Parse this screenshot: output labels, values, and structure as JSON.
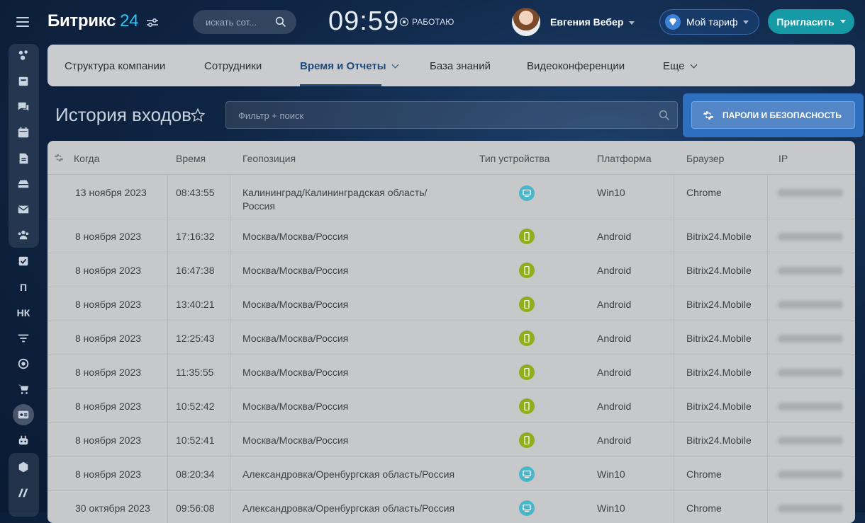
{
  "app": {
    "logo_name": "Битрикс",
    "logo_number": "24",
    "search_placeholder": "искать сот...",
    "clock": "09:59",
    "work_status": "РАБОТАЮ",
    "user_name": "Евгения Вебер",
    "tariff_label": "Мой тариф",
    "invite_label": "Пригласить"
  },
  "sidebar": {
    "items": [
      {
        "name": "feed-icon"
      },
      {
        "name": "tasks-icon"
      },
      {
        "name": "chat-icon"
      },
      {
        "name": "calendar-icon"
      },
      {
        "name": "document-icon"
      },
      {
        "name": "drive-icon"
      },
      {
        "name": "mail-icon"
      },
      {
        "name": "employees-icon"
      },
      {
        "name": "checklist-icon"
      },
      {
        "name": "text-item",
        "label": "П"
      },
      {
        "name": "text-item",
        "label": "НК"
      },
      {
        "name": "filter-icon"
      },
      {
        "name": "target-icon"
      },
      {
        "name": "cart-icon"
      },
      {
        "name": "id-card-icon"
      },
      {
        "name": "robot-icon"
      },
      {
        "name": "box-icon"
      },
      {
        "name": "logo-icon"
      }
    ]
  },
  "nav": {
    "items": [
      "Структура компании",
      "Сотрудники",
      "Время и Отчеты",
      "База знаний",
      "Видеоконференции",
      "Еще"
    ],
    "active": "Время и Отчеты"
  },
  "page": {
    "title": "История входов",
    "filter_placeholder": "Фильтр + поиск",
    "security_button": "ПАРОЛИ И БЕЗОПАСНОСТЬ"
  },
  "table": {
    "columns": [
      "Когда",
      "Время",
      "Геопозиция",
      "Тип устройства",
      "Платформа",
      "Браузер",
      "IP"
    ],
    "rows": [
      {
        "date": "13 ноября 2023",
        "time": "08:43:55",
        "geo": "Калининград/Калининградская область/\nРоссия",
        "device": "desktop",
        "platform": "Win10",
        "browser": "Chrome"
      },
      {
        "date": "8 ноября 2023",
        "time": "17:16:32",
        "geo": "Москва/Москва/Россия",
        "device": "mobile",
        "platform": "Android",
        "browser": "Bitrix24.Mobile"
      },
      {
        "date": "8 ноября 2023",
        "time": "16:47:38",
        "geo": "Москва/Москва/Россия",
        "device": "mobile",
        "platform": "Android",
        "browser": "Bitrix24.Mobile"
      },
      {
        "date": "8 ноября 2023",
        "time": "13:40:21",
        "geo": "Москва/Москва/Россия",
        "device": "mobile",
        "platform": "Android",
        "browser": "Bitrix24.Mobile"
      },
      {
        "date": "8 ноября 2023",
        "time": "12:25:43",
        "geo": "Москва/Москва/Россия",
        "device": "mobile",
        "platform": "Android",
        "browser": "Bitrix24.Mobile"
      },
      {
        "date": "8 ноября 2023",
        "time": "11:35:55",
        "geo": "Москва/Москва/Россия",
        "device": "mobile",
        "platform": "Android",
        "browser": "Bitrix24.Mobile"
      },
      {
        "date": "8 ноября 2023",
        "time": "10:52:42",
        "geo": "Москва/Москва/Россия",
        "device": "mobile",
        "platform": "Android",
        "browser": "Bitrix24.Mobile"
      },
      {
        "date": "8 ноября 2023",
        "time": "10:52:41",
        "geo": "Москва/Москва/Россия",
        "device": "mobile",
        "platform": "Android",
        "browser": "Bitrix24.Mobile"
      },
      {
        "date": "8 ноября 2023",
        "time": "08:20:34",
        "geo": "Александровка/Оренбургская область/Россия",
        "device": "desktop",
        "platform": "Win10",
        "browser": "Chrome"
      },
      {
        "date": "30 октября 2023",
        "time": "09:56:08",
        "geo": "Александровка/Оренбургская область/Россия",
        "device": "desktop",
        "platform": "Win10",
        "browser": "Chrome"
      }
    ]
  },
  "colors": {
    "accent": "#2fc6f6",
    "invite": "#159aa6",
    "security_highlight": "#2f6fbf",
    "device_desktop": "#4bb5c9",
    "device_mobile": "#8fae1b"
  }
}
